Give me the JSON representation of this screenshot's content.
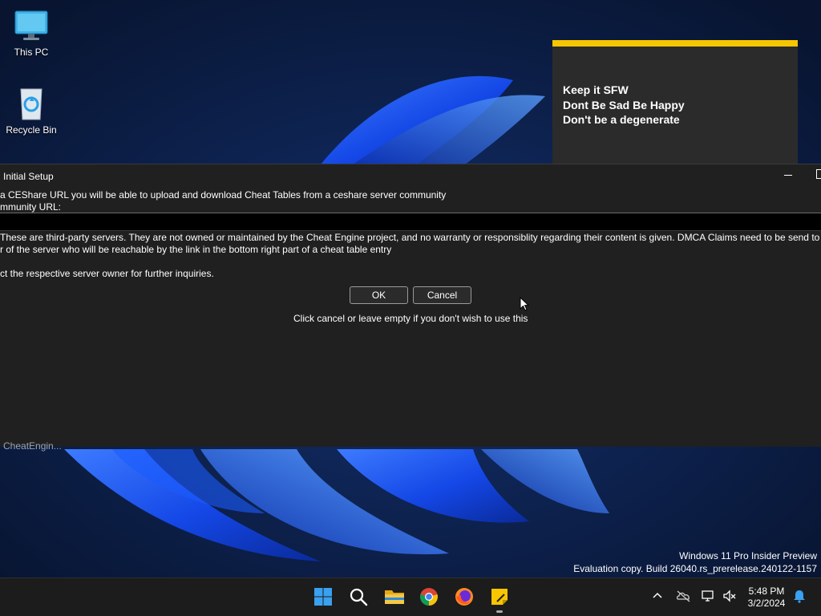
{
  "desktop": {
    "icons": [
      {
        "label": "This PC",
        "icon": "monitor-icon"
      },
      {
        "label": "Recycle Bin",
        "icon": "recycle-bin-icon"
      }
    ],
    "background_label": "CheatEngin..."
  },
  "sticky_note": {
    "accent_color": "#f7c600",
    "lines": [
      "Keep it SFW",
      "Dont Be Sad Be Happy",
      "Don't be a degenerate"
    ]
  },
  "dialog": {
    "title": "Initial Setup",
    "message_line1": "a CEShare URL you will be able to upload and download Cheat Tables from a ceshare server community",
    "message_line2": "mmunity URL:",
    "url_value": "",
    "warning_line1": "These are third-party servers. They are not owned or maintained by the Cheat Engine project, and no warranty or responsiblity regarding their content is given.  DMCA Claims need to be send to th",
    "warning_line2": "r of the server who will be reachable by the link in the bottom right part of a cheat table entry",
    "warning_line3": "ct the respective server owner for further inquiries.",
    "ok_label": "OK",
    "cancel_label": "Cancel",
    "hint": "Click cancel or leave empty if you don't wish to use this"
  },
  "watermark": {
    "line1": "Windows 11 Pro Insider Preview",
    "line2": "Evaluation copy. Build 26040.rs_prerelease.240122-1157"
  },
  "taskbar": {
    "apps": [
      "start-icon",
      "search-icon",
      "file-explorer-icon",
      "chrome-icon",
      "firefox-icon",
      "sticky-notes-icon"
    ],
    "time": "5:48 PM",
    "date": "3/2/2024"
  }
}
